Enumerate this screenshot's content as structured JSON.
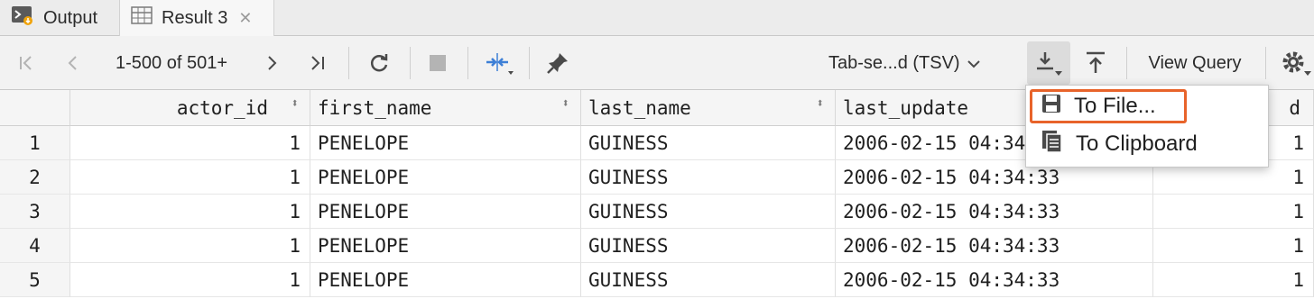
{
  "tabs": [
    {
      "label": "Output",
      "icon": "console-icon"
    },
    {
      "label": "Result 3",
      "icon": "table-icon"
    }
  ],
  "toolbar": {
    "pagination": "1-500 of 501+",
    "format": "Tab-se...d (TSV)",
    "view_query": "View Query"
  },
  "table": {
    "columns": [
      "actor_id",
      "first_name",
      "last_name",
      "last_update",
      "d"
    ],
    "rows": [
      {
        "n": "1",
        "actor_id": "1",
        "first_name": "PENELOPE",
        "last_name": "GUINESS",
        "last_update": "2006-02-15 04:34:33",
        "last": "1"
      },
      {
        "n": "2",
        "actor_id": "1",
        "first_name": "PENELOPE",
        "last_name": "GUINESS",
        "last_update": "2006-02-15 04:34:33",
        "last": "1"
      },
      {
        "n": "3",
        "actor_id": "1",
        "first_name": "PENELOPE",
        "last_name": "GUINESS",
        "last_update": "2006-02-15 04:34:33",
        "last": "1"
      },
      {
        "n": "4",
        "actor_id": "1",
        "first_name": "PENELOPE",
        "last_name": "GUINESS",
        "last_update": "2006-02-15 04:34:33",
        "last": "1"
      },
      {
        "n": "5",
        "actor_id": "1",
        "first_name": "PENELOPE",
        "last_name": "GUINESS",
        "last_update": "2006-02-15 04:34:33",
        "last": "1"
      }
    ]
  },
  "export_menu": {
    "items": [
      {
        "label": "To File...",
        "icon": "save-icon"
      },
      {
        "label": "To Clipboard",
        "icon": "clipboard-icon"
      }
    ]
  },
  "colors": {
    "accent": "#3d7fd6",
    "highlight": "#e8632a",
    "output_badge": "#f0a30a"
  }
}
